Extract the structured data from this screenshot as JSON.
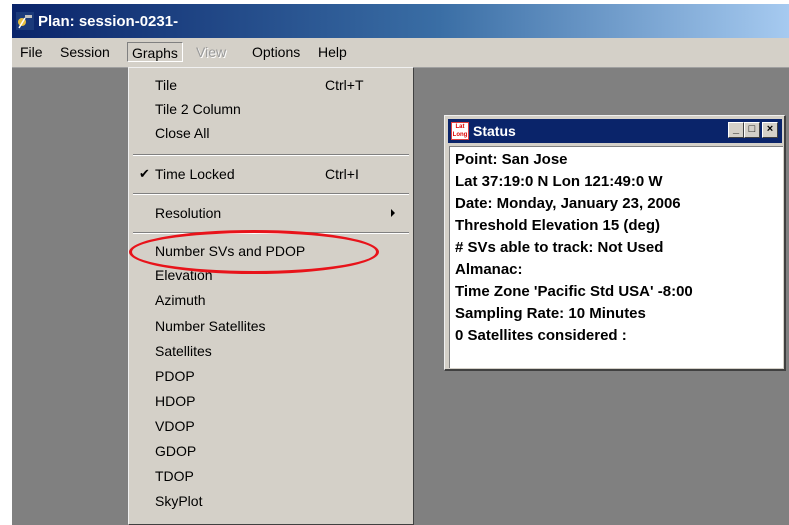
{
  "window": {
    "title": "Plan: session-0231-"
  },
  "menubar": {
    "items": [
      {
        "label": "File",
        "state": "normal"
      },
      {
        "label": "Session",
        "state": "normal"
      },
      {
        "label": "Graphs",
        "state": "open"
      },
      {
        "label": "View",
        "state": "disabled"
      },
      {
        "label": "Options",
        "state": "normal"
      },
      {
        "label": "Help",
        "state": "normal"
      }
    ]
  },
  "graphs_menu": {
    "items": [
      {
        "label": "Tile",
        "shortcut": "Ctrl+T"
      },
      {
        "label": "Tile 2 Column"
      },
      {
        "label": "Close All"
      },
      {
        "label": "Time Locked",
        "shortcut": "Ctrl+I",
        "checked": true
      },
      {
        "label": "Resolution",
        "submenu": true
      },
      {
        "label": "Number SVs and PDOP",
        "highlighted": true
      },
      {
        "label": "Elevation"
      },
      {
        "label": "Azimuth"
      },
      {
        "label": "Number Satellites"
      },
      {
        "label": "Satellites"
      },
      {
        "label": "PDOP"
      },
      {
        "label": "HDOP"
      },
      {
        "label": "VDOP"
      },
      {
        "label": "GDOP"
      },
      {
        "label": "TDOP"
      },
      {
        "label": "SkyPlot"
      }
    ],
    "check_glyph": "✔",
    "highlight_color": "#e8131a"
  },
  "status_window": {
    "title": "Status",
    "icon_name": "lat-long-icon",
    "icon_text": "Lat Long",
    "lines": [
      "Point: San Jose",
      "Lat 37:19:0 N   Lon 121:49:0 W",
      "Date: Monday, January 23, 2006",
      "Threshold Elevation 15 (deg)",
      "# SVs able to track: Not Used",
      "Almanac:",
      "Time Zone 'Pacific Std USA'  -8:00",
      "Sampling Rate: 10 Minutes",
      "0 Satellites considered :"
    ]
  }
}
